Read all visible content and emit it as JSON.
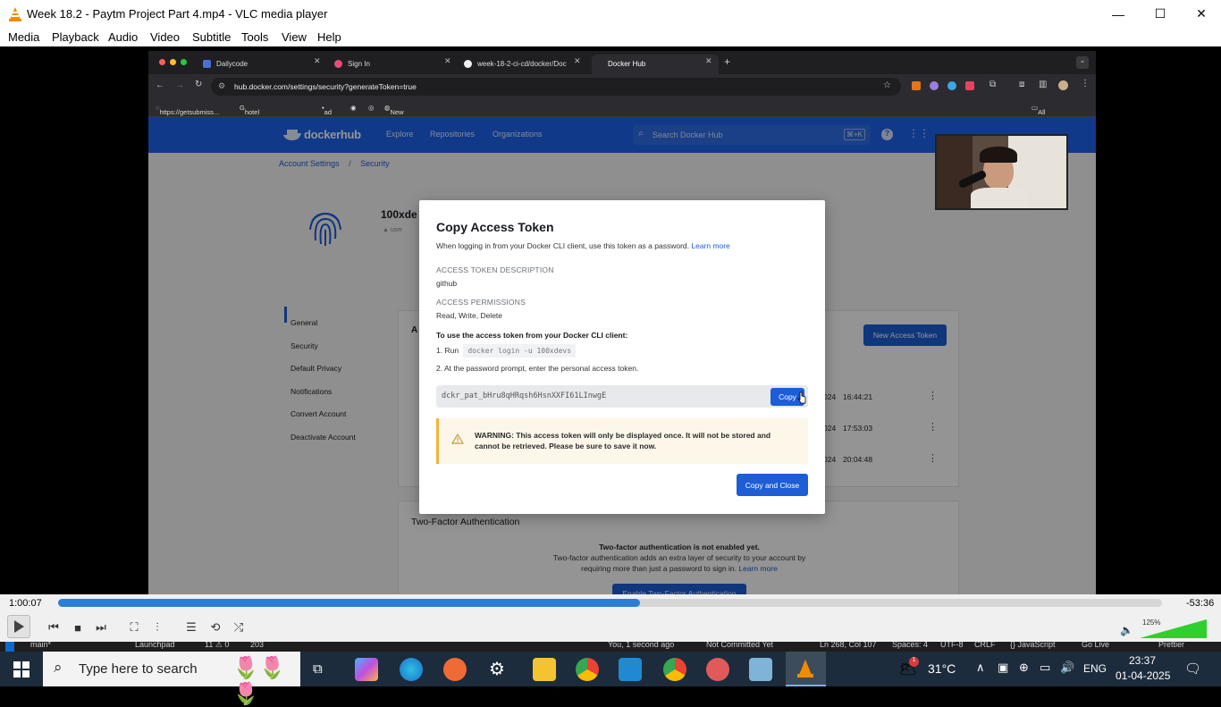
{
  "window": {
    "title": "Week 18.2 - Paytm Project Part 4.mp4 - VLC media player",
    "minimize": "—",
    "maximize": "☐",
    "close": "✕"
  },
  "menu": [
    "Media",
    "Playback",
    "Audio",
    "Video",
    "Subtitle",
    "Tools",
    "View",
    "Help"
  ],
  "browser": {
    "tabs": [
      {
        "label": "Dailycode"
      },
      {
        "label": "Sign In"
      },
      {
        "label": "week-18-2-ci-cd/docker/Doc"
      },
      {
        "label": "Docker Hub"
      }
    ],
    "url": "hub.docker.com/settings/security?generateToken=true",
    "bookmarks": [
      "https://getsubmiss...",
      "hotel in paris - Go...",
      "ad",
      "New Tab"
    ],
    "all_bookmarks": "All Bookmarks"
  },
  "dockerhub": {
    "logo": "dockerhub",
    "nav": [
      "Explore",
      "Repositories",
      "Organizations"
    ],
    "search_placeholder": "Search Docker Hub",
    "search_shortcut": "⌘+K",
    "breadcrumb": [
      "Account Settings",
      "/",
      "Security"
    ],
    "username": "100xde",
    "user_role": "user",
    "sidebar": [
      "General",
      "Security",
      "Default Privacy",
      "Notifications",
      "Convert Account",
      "Deactivate Account"
    ],
    "new_token_button": "New Access Token",
    "token_rows": [
      {
        "date": "024",
        "time": "16:44:21"
      },
      {
        "date": "024",
        "time": "17:53:03"
      },
      {
        "date": "024",
        "time": "20:04:48"
      }
    ],
    "section_initial": "A",
    "two_factor": {
      "title": "Two-Factor Authentication",
      "status": "Two-factor authentication is not enabled yet.",
      "desc1": "Two-factor authentication adds an extra layer of security to your account by",
      "desc2": "requiring more than just a password to sign in.",
      "learn_more": "Learn more",
      "button": "Enable Two-Factor Authentication"
    }
  },
  "modal": {
    "title": "Copy Access Token",
    "intro": "When logging in from your Docker CLI client, use this token as a password.",
    "learn_more": "Learn more",
    "desc_label": "ACCESS TOKEN DESCRIPTION",
    "desc_value": "github",
    "perm_label": "ACCESS PERMISSIONS",
    "perm_value": "Read, Write, Delete",
    "howto": "To use the access token from your Docker CLI client:",
    "step1_prefix": "1. Run",
    "step1_cmd": "docker login -u 100xdevs",
    "step2": "2. At the password prompt, enter the personal access token.",
    "token": "dckr_pat_bHru8qHRqsh6HsnXXFI61LInwgE",
    "copy": "Copy",
    "warning_line1": "WARNING: This access token will only be displayed once. It will not be stored and",
    "warning_line2": "cannot be retrieved. Please be sure to save it now.",
    "copy_close": "Copy and Close"
  },
  "player": {
    "elapsed": "1:00:07",
    "remaining": "-53:36",
    "progress": 0.527,
    "volume_label": "125%",
    "volume": 1.0
  },
  "ide_status": {
    "left": [
      "main*",
      "Launchpad",
      "11 ⚠ 0",
      "203"
    ],
    "right": [
      "You, 1 second ago",
      "Not Committed Yet",
      "Ln 268, Col 107",
      "Spaces: 4",
      "UTF-8",
      "CRLF",
      "{} JavaScript",
      "Go Live",
      "Prettier"
    ]
  },
  "taskbar": {
    "search_placeholder": "Type here to search",
    "weather": "31°C",
    "lang": "ENG",
    "time": "23:37",
    "date": "01-04-2025",
    "notif_count": "1"
  },
  "colors": {
    "docker_blue": "#1d63ed",
    "button_blue": "#1d5dd6",
    "vlc_orange": "#f08c00",
    "seek_blue": "#2a7fd5"
  }
}
